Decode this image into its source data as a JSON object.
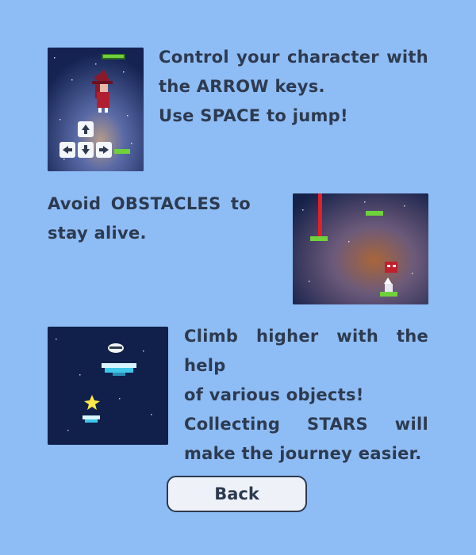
{
  "instructions": {
    "controls": {
      "lines": [
        "Control your character with",
        "the ARROW keys.",
        "Use SPACE to jump!"
      ]
    },
    "obstacles": {
      "lines": [
        "Avoid OBSTACLES to",
        "stay alive."
      ]
    },
    "objects": {
      "lines": [
        "Climb higher with the help",
        "of various objects!",
        "Collecting STARS will",
        "make the journey easier."
      ]
    }
  },
  "back_button": {
    "label": "Back"
  },
  "icons": {
    "arrow_keys": [
      "up-arrow-key-icon",
      "left-arrow-key-icon",
      "down-arrow-key-icon",
      "right-arrow-key-icon"
    ],
    "objects": [
      "saucer-icon",
      "trampoline-icon",
      "star-icon"
    ]
  },
  "colors": {
    "background": "#8ebcf5",
    "text": "#2d3a4f",
    "platform": "#6fd13c",
    "obstacle_laser": "#e0202a",
    "space_bg": "#0e1a3d",
    "star": "#ffe94a",
    "button_bg": "#eef2f8"
  }
}
